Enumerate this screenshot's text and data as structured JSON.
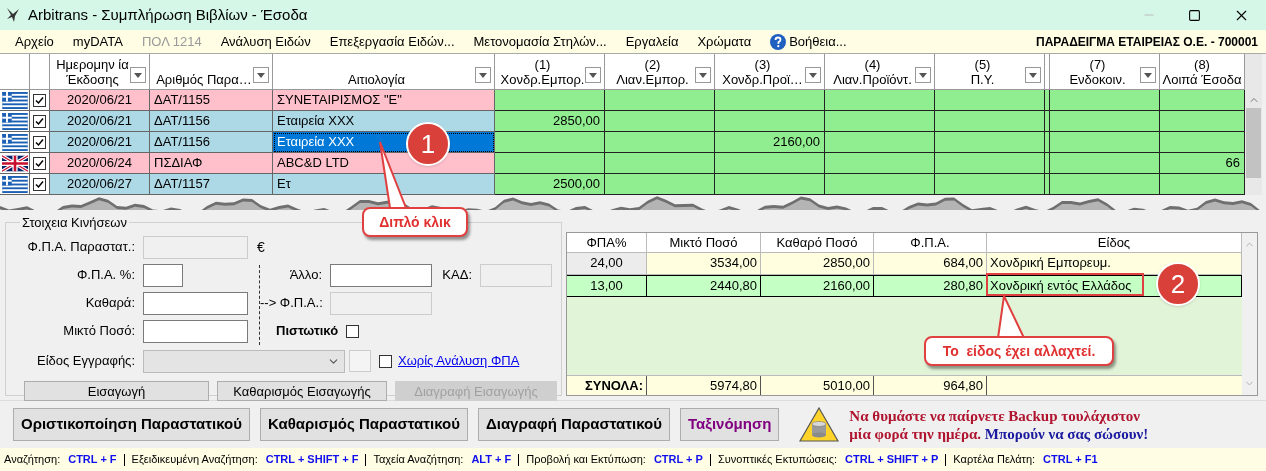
{
  "window": {
    "title": "Arbitrans - Συμπλήρωση Βιβλίων - Έσοδα"
  },
  "menu": [
    {
      "label": "Αρχείο",
      "disabled": false,
      "kind": "plain"
    },
    {
      "label": "myDATA",
      "disabled": false,
      "kind": "plain"
    },
    {
      "label": "ΠΟΛ 1214",
      "disabled": true,
      "kind": "plain"
    },
    {
      "label": "Ανάλυση Ειδών",
      "disabled": false,
      "kind": "plain"
    },
    {
      "label": "Επεξεργασία Ειδών...",
      "disabled": false,
      "kind": "plain"
    },
    {
      "label": "Μετονομασία Στηλών...",
      "disabled": false,
      "kind": "plain"
    },
    {
      "label": "Εργαλεία",
      "disabled": false,
      "kind": "plain"
    },
    {
      "label": "Χρώματα",
      "disabled": false,
      "kind": "plain"
    },
    {
      "label": "Βοήθεια...",
      "disabled": false,
      "kind": "help"
    }
  ],
  "company": "ΠΑΡΑΔΕΙΓΜΑ ΕΤΑΙΡΕΙΑΣ Ο.Ε. - 700001",
  "grid": {
    "columns": [
      {
        "lines": [
          "Ημερομην ία",
          "Έκδοσης"
        ],
        "filter": true
      },
      {
        "lines": [
          "Αριθμός Παρα…"
        ],
        "filter": true
      },
      {
        "lines": [
          "Αιτιολογία"
        ],
        "filter": true
      },
      {
        "lines": [
          "(1)",
          "Χονδρ.Εμπορ."
        ],
        "filter": true
      },
      {
        "lines": [
          "(2)",
          "Λιαν.Εμπορ."
        ],
        "filter": true
      },
      {
        "lines": [
          "(3)",
          "Χονδρ.Προϊ…"
        ],
        "filter": true
      },
      {
        "lines": [
          "(4)",
          "Λιαν.Προϊόντ."
        ],
        "filter": true
      },
      {
        "lines": [
          "(5)",
          "Π.Υ."
        ],
        "filter": true
      },
      {
        "lines": [
          "(7)",
          "Ενδοκοιν."
        ],
        "filter": true
      },
      {
        "lines": [
          "(8)",
          "Λοιπά Έσοδα"
        ],
        "filter": false
      }
    ],
    "rows": [
      {
        "kind": "greece",
        "checked": true,
        "color": "#ffc0cb",
        "selected": false,
        "date": "2020/06/21",
        "doc": "ΔΑΤ/1155",
        "reason": "ΣΥΝΕΤΑΙΡΙΣΜΟΣ \"Ε\""
      },
      {
        "kind": "greece",
        "checked": true,
        "color": "#add8e6",
        "selected": false,
        "date": "2020/06/21",
        "doc": "ΔΑΤ/1156",
        "reason": "Εταιρεία XXX",
        "wholesale_goods": "2850,00"
      },
      {
        "kind": "greece",
        "checked": true,
        "color": "#add8e6",
        "selected": true,
        "date": "2020/06/21",
        "doc": "ΔΑΤ/1156",
        "reason": "Εταιρεία XXX",
        "wholesale_products": "2160,00"
      },
      {
        "kind": "uk",
        "checked": true,
        "color": "#ffc0cb",
        "selected": false,
        "date": "2020/06/24",
        "doc": "ΠΣΔΙΑΦ",
        "reason": "ABC&D LTD",
        "other_income": "66"
      },
      {
        "kind": "greece",
        "checked": true,
        "color": "#add8e6",
        "selected": false,
        "date": "2020/06/27",
        "doc": "ΔΑΤ/1157",
        "reason": "Ετ",
        "wholesale_goods": "2500,00"
      }
    ]
  },
  "entry_form": {
    "title": "Στοιχεια Κινήσεων",
    "vat_doc": {
      "label": "Φ.Π.Α. Παραστατ.:",
      "disabled": true,
      "unit": "€"
    },
    "vat_pct": {
      "label": "Φ.Π.Α. %:",
      "disabled": false
    },
    "net": {
      "label": "Καθαρά:",
      "disabled": false
    },
    "gross": {
      "label": "Μικτό Ποσό:",
      "disabled": false
    },
    "other": {
      "label": "Άλλο:",
      "disabled": false
    },
    "kad": {
      "label": "ΚΑΔ:",
      "disabled": true
    },
    "to_vat": {
      "label": "--> Φ.Π.Α.:",
      "disabled": true
    },
    "credit": {
      "label": "Πιστωτικό",
      "checked": false
    },
    "entry_type": {
      "label": "Είδος Εγγραφής:",
      "disabled": true
    },
    "no_vat": {
      "label": "Χωρίς Ανάλυση ΦΠΑ",
      "checked": false
    },
    "buttons": [
      {
        "label": "Εισαγωγή",
        "disabled": false
      },
      {
        "label": "Καθαρισμός Εισαγωγής",
        "disabled": false
      },
      {
        "label": "Διαγραφή Εισαγωγής",
        "disabled": true
      }
    ]
  },
  "vat_table": {
    "columns": [
      "ΦΠΑ%",
      "Μικτό Ποσό",
      "Καθαρό Ποσό",
      "Φ.Π.Α.",
      "Είδος"
    ],
    "rows": [
      {
        "selected": false,
        "color": "#ffffe0",
        "cells": [
          "24,00",
          "3534,00",
          "2850,00",
          "684,00",
          "Χονδρική Εμπορευμ."
        ]
      },
      {
        "selected": true,
        "color": "#c4ffc4",
        "cells": [
          "13,00",
          "2440,80",
          "2160,00",
          "280,80",
          "Χονδρική εντός Ελλάδος"
        ]
      }
    ],
    "totals": {
      "label": "ΣΥΝΟΛΑ:",
      "values": [
        "5974,80",
        "5010,00",
        "964,80"
      ]
    }
  },
  "actions": [
    {
      "label": "Οριστικοποίηση Παραστατικού",
      "color": "#000000"
    },
    {
      "label": "Καθαρισμός Παραστατικού",
      "color": "#000000"
    },
    {
      "label": "Διαγραφή Παραστατικού",
      "color": "#000000"
    },
    {
      "label": "Ταξινόμηση",
      "color": "#800080"
    }
  ],
  "notice": [
    {
      "text": "Να θυμάστε να παίρνετε Backup τουλάχιστον",
      "color": "#b01530"
    },
    {
      "text": "μία φορά την ημέρα.",
      "color": "#b01530"
    },
    {
      "text": "Μπορούν να σας σώσουν!",
      "color": "#1a1aa0"
    }
  ],
  "status_bar": [
    {
      "label": "Αναζήτηση:",
      "keys": "CTRL + F"
    },
    {
      "label": "Εξειδικευμένη Αναζήτηση:",
      "keys": "CTRL + SHIFT + F"
    },
    {
      "label": "Ταχεία Αναζήτηση:",
      "keys": "ALT + F"
    },
    {
      "label": "Προβολή και Εκτύπωση:",
      "keys": "CTRL + P"
    },
    {
      "label": "Συνοπτικές Εκτυπώσεις:",
      "keys": "CTRL + SHIFT + P"
    },
    {
      "label": "Καρτέλα Πελάτη:",
      "keys": "CTRL + F1"
    }
  ],
  "callouts": [
    {
      "number": "1",
      "text": "Διπλό κλικ"
    },
    {
      "number": "2",
      "text": "Το  είδος έχει αλλαχτεί."
    }
  ]
}
